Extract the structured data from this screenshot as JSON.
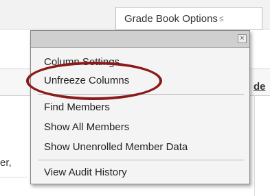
{
  "toolbar": {
    "options_label": "Grade Book Options",
    "options_chevron": "≤"
  },
  "background": {
    "header_right_label": "de",
    "row_text": "er,"
  },
  "menu": {
    "close_label": "×",
    "items": [
      {
        "label": "Column Settings"
      },
      {
        "label": "Unfreeze Columns"
      },
      {
        "label": "Find Members"
      },
      {
        "label": "Show All Members"
      },
      {
        "label": "Show Unenrolled Member Data"
      },
      {
        "label": "View Audit History"
      }
    ]
  },
  "annotation": {
    "highlight_color": "#8b1a1a"
  }
}
